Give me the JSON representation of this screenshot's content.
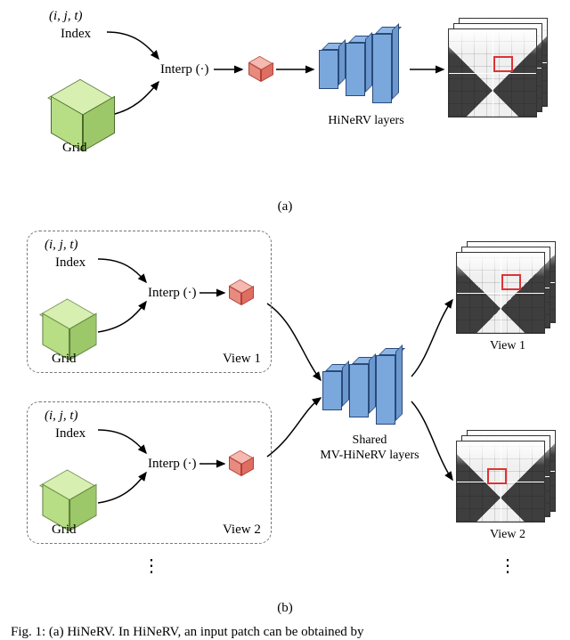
{
  "figure": {
    "number": "Fig. 1",
    "panel_a_label": "(a)",
    "panel_b_label": "(b)",
    "footer_fragment": "Fig. 1: (a) HiNeRV. In HiNeRV, an input patch can be obtained by"
  },
  "panel_a": {
    "index_expr": "(i, j, t)",
    "index_label": "Index",
    "grid_label": "Grid",
    "interp_label": "Interp (·)",
    "net_label": "HiNeRV layers"
  },
  "panel_b": {
    "view1": {
      "index_expr": "(i, j, t)",
      "index_label": "Index",
      "grid_label": "Grid",
      "interp_label": "Interp (·)",
      "view_label": "View 1",
      "out_label": "View 1"
    },
    "view2": {
      "index_expr": "(i, j, t)",
      "index_label": "Index",
      "grid_label": "Grid",
      "interp_label": "Interp (·)",
      "view_label": "View 2",
      "out_label": "View 2"
    },
    "net_label_line1": "Shared",
    "net_label_line2": "MV-HiNeRV layers",
    "vdots": "⋮"
  }
}
